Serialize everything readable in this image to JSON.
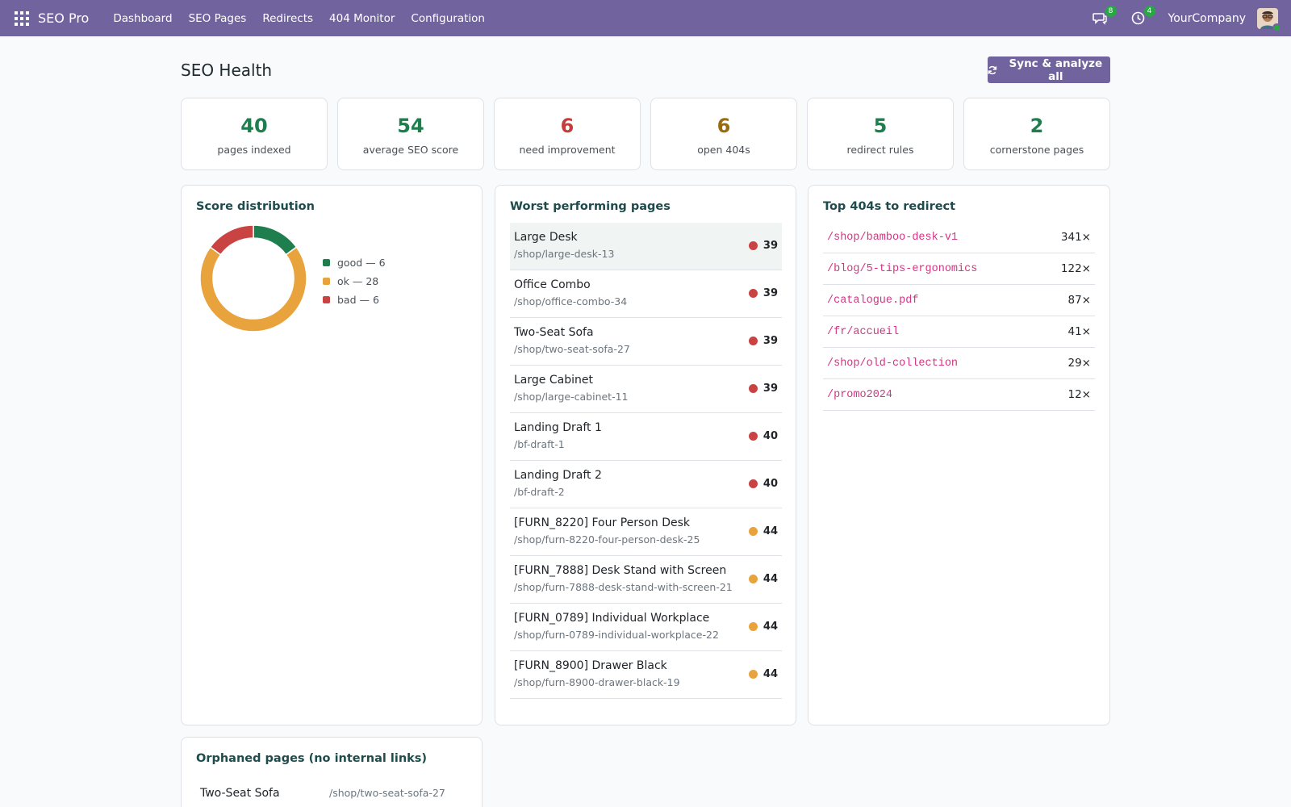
{
  "navbar": {
    "brand": "SEO Pro",
    "menu": [
      "Dashboard",
      "SEO Pages",
      "Redirects",
      "404 Monitor",
      "Configuration"
    ],
    "messages_badge": "8",
    "activities_badge": "4",
    "company": "YourCompany"
  },
  "page": {
    "title": "SEO Health",
    "sync_button": "Sync & analyze all"
  },
  "kpis": [
    {
      "value": "40",
      "label": "pages indexed",
      "color": "#1e7e4e"
    },
    {
      "value": "54",
      "label": "average SEO score",
      "color": "#1e7e4e"
    },
    {
      "value": "6",
      "label": "need improvement",
      "color": "#c63b3b"
    },
    {
      "value": "6",
      "label": "open 404s",
      "color": "#9a6b0e"
    },
    {
      "value": "5",
      "label": "redirect rules",
      "color": "#1e7e4e"
    },
    {
      "value": "2",
      "label": "cornerstone pages",
      "color": "#1e7e4e"
    }
  ],
  "score_distribution": {
    "title": "Score distribution",
    "chart_data": {
      "type": "pie",
      "variant": "donut",
      "categories": [
        "good",
        "ok",
        "bad"
      ],
      "values": [
        6,
        28,
        6
      ],
      "colors": [
        "#1e7e4e",
        "#e8a33d",
        "#c94343"
      ],
      "legend_placement": "right"
    },
    "legend": [
      {
        "label": "good — 6",
        "color": "#1e7e4e"
      },
      {
        "label": "ok — 28",
        "color": "#e8a33d"
      },
      {
        "label": "bad — 6",
        "color": "#c94343"
      }
    ]
  },
  "worst_pages": {
    "title": "Worst performing pages",
    "rows": [
      {
        "name": "Large Desk",
        "url": "/shop/large-desk-13",
        "score": "39",
        "status": "bad"
      },
      {
        "name": "Office Combo",
        "url": "/shop/office-combo-34",
        "score": "39",
        "status": "bad"
      },
      {
        "name": "Two-Seat Sofa",
        "url": "/shop/two-seat-sofa-27",
        "score": "39",
        "status": "bad"
      },
      {
        "name": "Large Cabinet",
        "url": "/shop/large-cabinet-11",
        "score": "39",
        "status": "bad"
      },
      {
        "name": "Landing Draft 1",
        "url": "/bf-draft-1",
        "score": "40",
        "status": "bad"
      },
      {
        "name": "Landing Draft 2",
        "url": "/bf-draft-2",
        "score": "40",
        "status": "bad"
      },
      {
        "name": "[FURN_8220] Four Person Desk",
        "url": "/shop/furn-8220-four-person-desk-25",
        "score": "44",
        "status": "ok"
      },
      {
        "name": "[FURN_7888] Desk Stand with Screen",
        "url": "/shop/furn-7888-desk-stand-with-screen-21",
        "score": "44",
        "status": "ok"
      },
      {
        "name": "[FURN_0789] Individual Workplace",
        "url": "/shop/furn-0789-individual-workplace-22",
        "score": "44",
        "status": "ok"
      },
      {
        "name": "[FURN_8900] Drawer Black",
        "url": "/shop/furn-8900-drawer-black-19",
        "score": "44",
        "status": "ok"
      }
    ]
  },
  "top_404s": {
    "title": "Top 404s to redirect",
    "rows": [
      {
        "url": "/shop/bamboo-desk-v1",
        "count": "341×"
      },
      {
        "url": "/blog/5-tips-ergonomics",
        "count": "122×"
      },
      {
        "url": "/catalogue.pdf",
        "count": "87×"
      },
      {
        "url": "/fr/accueil",
        "count": "41×"
      },
      {
        "url": "/shop/old-collection",
        "count": "29×"
      },
      {
        "url": "/promo2024",
        "count": "12×"
      }
    ]
  },
  "orphaned": {
    "title": "Orphaned pages (no internal links)",
    "rows": [
      {
        "name": "Two-Seat Sofa",
        "url": "/shop/two-seat-sofa-27"
      }
    ]
  },
  "status_colors": {
    "bad": "#c94343",
    "ok": "#e8a33d",
    "good": "#1e7e4e"
  }
}
